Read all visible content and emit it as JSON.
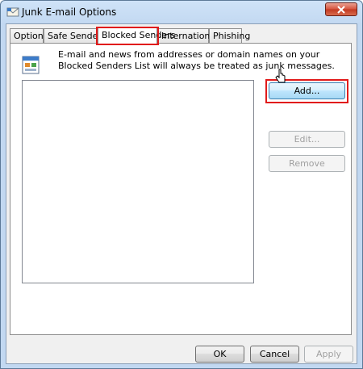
{
  "window": {
    "title": "Junk E-mail Options"
  },
  "tabs": [
    {
      "label": "Options"
    },
    {
      "label": "Safe Senders"
    },
    {
      "label": "Blocked Senders"
    },
    {
      "label": "International"
    },
    {
      "label": "Phishing"
    }
  ],
  "panel": {
    "description": "E-mail and news from addresses or domain names on your Blocked Senders List will always be treated as junk messages.",
    "add_label": "Add...",
    "edit_label": "Edit...",
    "remove_label": "Remove"
  },
  "footer": {
    "ok_label": "OK",
    "cancel_label": "Cancel",
    "apply_label": "Apply"
  },
  "colors": {
    "highlight": "#e11a1a",
    "titlebar": "#c2d8f1",
    "close": "#c23a22"
  },
  "icons": {
    "title": "mail-envelope-icon",
    "info": "window-list-icon",
    "close": "close-icon"
  }
}
